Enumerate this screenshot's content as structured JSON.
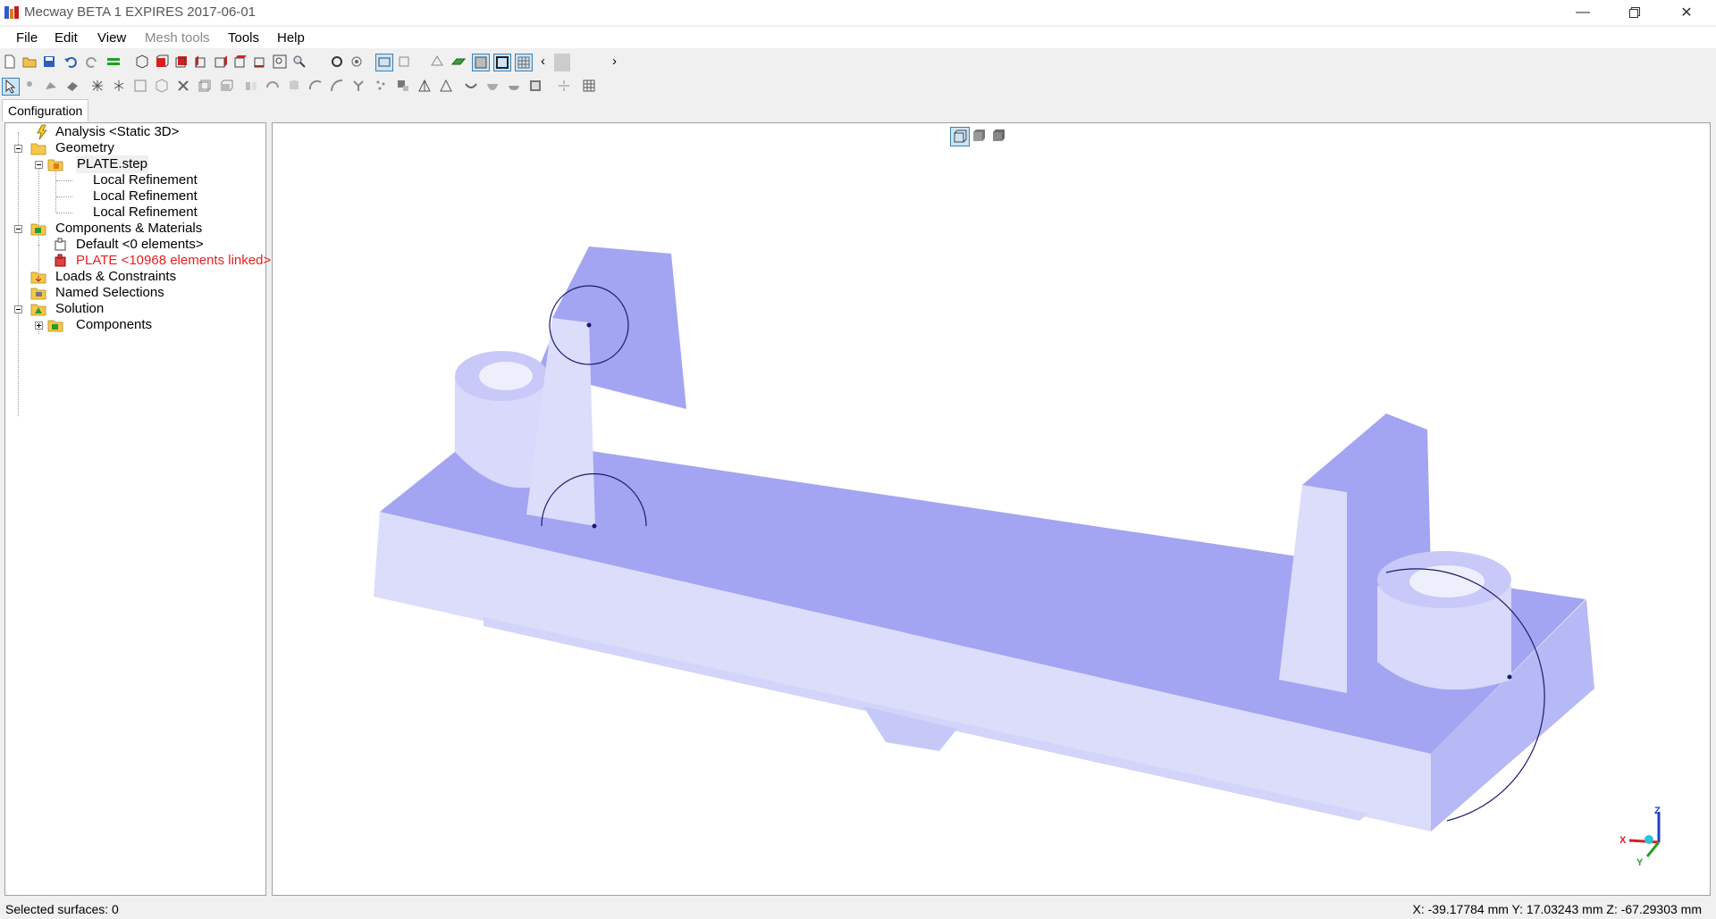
{
  "window": {
    "title": "Mecway BETA 1 EXPIRES 2017-06-01",
    "minimize_icon": "minimize-icon",
    "restore_icon": "restore-icon",
    "close_icon": "close-icon"
  },
  "menu": {
    "file": "File",
    "edit": "Edit",
    "view": "View",
    "mesh_tools": "Mesh tools",
    "tools": "Tools",
    "help": "Help"
  },
  "tabs": {
    "configuration": "Configuration"
  },
  "tree": {
    "analysis": "Analysis <Static 3D>",
    "geometry": "Geometry",
    "plate_step": "PLATE.step",
    "local_refinement_1": "Local Refinement",
    "local_refinement_2": "Local Refinement",
    "local_refinement_3": "Local Refinement",
    "components_materials": "Components & Materials",
    "default_component": "Default <0 elements>",
    "plate_component": "PLATE <10968 elements linked>",
    "loads_constraints": "Loads & Constraints",
    "named_selections": "Named Selections",
    "solution": "Solution",
    "solution_components": "Components"
  },
  "viewport": {
    "axis_x": "X",
    "axis_y": "Y",
    "axis_z": "Z",
    "model_color": "#a3a5f2",
    "model_light_color": "#dcddfb"
  },
  "status": {
    "selected": "Selected surfaces: 0",
    "coords": "X: -39.17784 mm Y: 17.03243 mm Z: -67.29303 mm"
  },
  "colors": {
    "selection_border": "#3c7fb1",
    "error_text": "#e52020"
  }
}
